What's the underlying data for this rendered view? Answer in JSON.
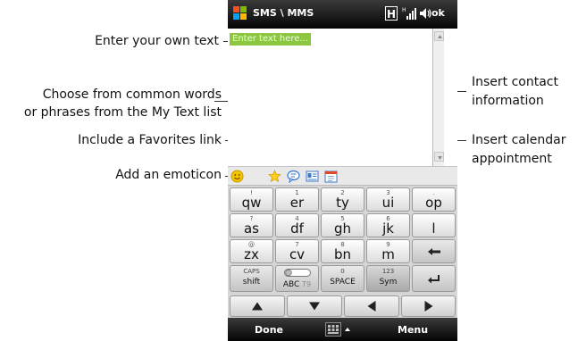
{
  "callouts": {
    "own_text": "Enter your own text",
    "common_words_line1": "Choose from common words",
    "common_words_line2": "or phrases from the My Text list",
    "favorites": "Include a Favorites link",
    "emoticon": "Add an emoticon",
    "contact_line1": "Insert contact",
    "contact_line2": "information",
    "calendar_line1": "Insert calendar",
    "calendar_line2": "appointment"
  },
  "titlebar": {
    "title": "SMS \\ MMS",
    "network_badge": "H",
    "ok_label": "ok"
  },
  "composer": {
    "placeholder": "Enter text here..."
  },
  "toolbar": {
    "icons": [
      "emoticon-icon",
      "favorites-star-icon",
      "my-text-icon",
      "contact-card-icon",
      "calendar-icon"
    ]
  },
  "keypad": {
    "rows": [
      [
        {
          "num": "!",
          "letters": "qw"
        },
        {
          "num": "1",
          "letters": "er"
        },
        {
          "num": "2",
          "letters": "ty"
        },
        {
          "num": "3",
          "letters": "ui"
        },
        {
          "num": ".",
          "letters": "op"
        }
      ],
      [
        {
          "num": "?",
          "letters": "as"
        },
        {
          "num": "4",
          "letters": "df"
        },
        {
          "num": "5",
          "letters": "gh"
        },
        {
          "num": "6",
          "letters": "jk"
        },
        {
          "num": "",
          "letters": "l"
        }
      ],
      [
        {
          "num": "@",
          "letters": "zx"
        },
        {
          "num": "7",
          "letters": "cv"
        },
        {
          "num": "8",
          "letters": "bn"
        },
        {
          "num": "9",
          "letters": "m"
        }
      ]
    ],
    "caps_top": "CAPS",
    "caps_bottom": "shift",
    "abc_label": "ABC",
    "t9_label": "T9",
    "space_top": "0",
    "space_bottom": "SPACE",
    "sym_top": "123",
    "sym_bottom": "Sym"
  },
  "softkeys": {
    "left": "Done",
    "right": "Menu"
  },
  "colors": {
    "placeholder_bg": "#8dc63f",
    "bar_dark": "#050505"
  }
}
